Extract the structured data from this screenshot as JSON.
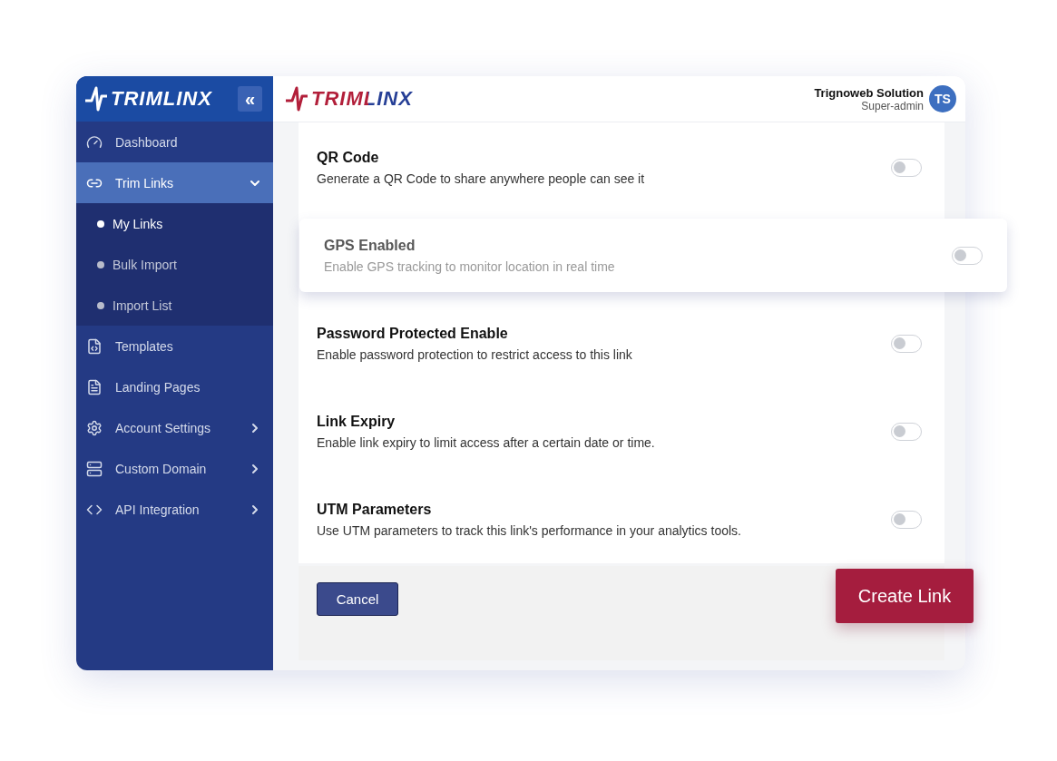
{
  "sidebar": {
    "logo": "TRIMLINX",
    "collapse_button": "«",
    "items": [
      {
        "label": "Dashboard",
        "selected": false
      },
      {
        "label": "Trim Links",
        "selected": true,
        "expanded": true,
        "children": [
          {
            "label": "My Links",
            "selected": true
          },
          {
            "label": "Bulk Import",
            "selected": false
          },
          {
            "label": "Import List",
            "selected": false
          }
        ]
      },
      {
        "label": "Templates",
        "selected": false
      },
      {
        "label": "Landing Pages",
        "selected": false
      },
      {
        "label": "Account Settings",
        "selected": false,
        "expanded": false
      },
      {
        "label": "Custom Domain",
        "selected": false,
        "expanded": false
      },
      {
        "label": "API Integration",
        "selected": false,
        "expanded": false
      }
    ]
  },
  "header": {
    "logo": "TRIMLINX",
    "user_name": "Trignoweb Solution",
    "user_role": "Super-admin",
    "avatar": "TS"
  },
  "settings": [
    {
      "kind": "plain",
      "title": "QR Code",
      "description": "Generate a QR Code to share anywhere people can see it",
      "on": false
    },
    {
      "kind": "highlight",
      "title": "GPS Enabled",
      "description": "Enable GPS tracking to monitor location in real time",
      "on": false
    },
    {
      "kind": "plain",
      "title": "Password Protected Enable",
      "description": "Enable password protection to restrict access to this link",
      "on": false
    },
    {
      "kind": "plain",
      "title": "Link Expiry",
      "description": "Enable link expiry to limit access after a certain date or time.",
      "on": false
    },
    {
      "kind": "plain",
      "title": "UTM Parameters",
      "description": "Use UTM parameters to track this link's performance in your analytics tools.",
      "on": false
    }
  ],
  "buttons": {
    "cancel": "Cancel",
    "create": "Create Link"
  }
}
